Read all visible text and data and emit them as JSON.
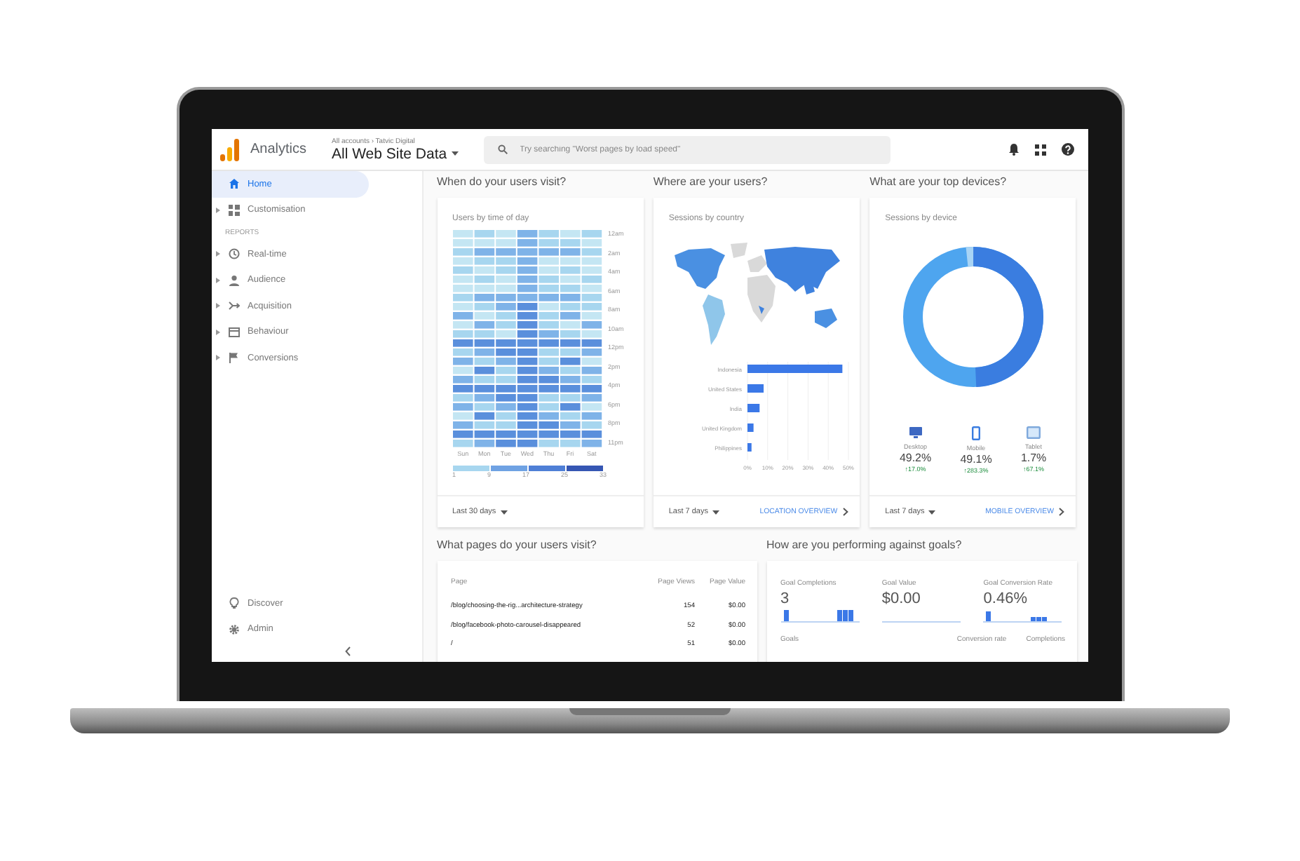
{
  "header": {
    "app_name": "Analytics",
    "breadcrumb": "All accounts › Tatvic Digital",
    "view": "All Web Site Data",
    "search": {
      "placeholder": "Try searching \"Worst pages by load speed\""
    }
  },
  "sidebar": {
    "top_items": [
      {
        "label": "Home",
        "selected": true,
        "expandable": false
      },
      {
        "label": "Customisation",
        "selected": false,
        "expandable": true
      }
    ],
    "reports_heading": "REPORTS",
    "report_items": [
      {
        "label": "Real-time",
        "selected": false,
        "expandable": true
      },
      {
        "label": "Audience",
        "selected": false,
        "expandable": true
      },
      {
        "label": "Acquisition",
        "selected": false,
        "expandable": true
      },
      {
        "label": "Behaviour",
        "selected": false,
        "expandable": true
      },
      {
        "label": "Conversions",
        "selected": false,
        "expandable": true
      }
    ],
    "bottom_items": [
      {
        "label": "Discover",
        "selected": false
      },
      {
        "label": "Admin",
        "selected": false
      }
    ]
  },
  "time_card": {
    "title": "When do your users visit?",
    "subtitle": "Users by time of day",
    "hour_labels": [
      "12am",
      "2am",
      "4am",
      "6am",
      "8am",
      "10am",
      "12pm",
      "2pm",
      "4pm",
      "6pm",
      "8pm",
      "11pm"
    ],
    "day_labels": [
      "Sun",
      "Mon",
      "Tue",
      "Wed",
      "Thu",
      "Fri",
      "Sat"
    ],
    "legend_labels": [
      "1",
      "9",
      "17",
      "25",
      "33"
    ],
    "date_range": "Last 30 days"
  },
  "location_card": {
    "title": "Where are your users?",
    "subtitle": "Sessions by country",
    "chart_data": {
      "type": "bar",
      "orientation": "horizontal",
      "categories": [
        "Indonesia",
        "United States",
        "India",
        "United Kingdom",
        "Philippines"
      ],
      "values": [
        47,
        8,
        6,
        3,
        2
      ],
      "grid": true,
      "xlim": [
        0,
        50
      ],
      "xticks": [
        {
          "value": 0,
          "label": "0%"
        },
        {
          "value": 10,
          "label": "10%"
        },
        {
          "value": 20,
          "label": "20%"
        },
        {
          "value": 30,
          "label": "30%"
        },
        {
          "value": 40,
          "label": "40%"
        },
        {
          "value": 50,
          "label": "50%"
        }
      ]
    },
    "date_range": "Last 7 days",
    "link": "LOCATION OVERVIEW"
  },
  "devices_card": {
    "title": "What are your top devices?",
    "subtitle": "Sessions by device",
    "devices": [
      {
        "label": "Desktop",
        "share": "49.2%",
        "change": "↑17.0%"
      },
      {
        "label": "Mobile",
        "share": "49.1%",
        "change": "↑283.3%"
      },
      {
        "label": "Tablet",
        "share": "1.7%",
        "change": "↑67.1%"
      }
    ],
    "date_range": "Last 7 days",
    "link": "MOBILE OVERVIEW"
  },
  "pages_card": {
    "title": "What pages do your users visit?",
    "columns": [
      "Page",
      "Page Views",
      "Page Value"
    ],
    "rows": [
      [
        "/blog/choosing-the-rig...architecture-strategy",
        "154",
        "$0.00"
      ],
      [
        "/blog/facebook-photo-carousel-disappeared",
        "52",
        "$0.00"
      ],
      [
        "/",
        "51",
        "$0.00"
      ]
    ]
  },
  "goals_card": {
    "title": "How are you performing against goals?",
    "metrics": [
      {
        "label": "Goal Completions",
        "value": "3"
      },
      {
        "label": "Goal Value",
        "value": "$0.00"
      },
      {
        "label": "Goal Conversion Rate",
        "value": "0.46%"
      }
    ],
    "columns": [
      "Goals",
      "Conversion rate",
      "Completions"
    ]
  }
}
